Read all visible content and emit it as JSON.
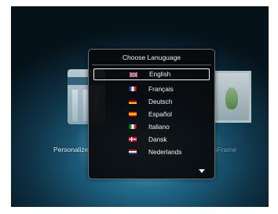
{
  "dialog": {
    "title": "Choose Lanuguage",
    "languages": [
      {
        "label": "English",
        "flag": "uk-flag-icon",
        "selected": true
      },
      {
        "label": "Français",
        "flag": "france-flag-icon",
        "selected": false
      },
      {
        "label": "Deutsch",
        "flag": "germany-flag-icon",
        "selected": false
      },
      {
        "label": "Español",
        "flag": "spain-flag-icon",
        "selected": false
      },
      {
        "label": "Italiano",
        "flag": "italy-flag-icon",
        "selected": false
      },
      {
        "label": "Dansk",
        "flag": "denmark-flag-icon",
        "selected": false
      },
      {
        "label": "Nederlands",
        "flag": "netherlands-flag-icon",
        "selected": false
      }
    ]
  },
  "background": {
    "left_label": "Personalize Frame",
    "right_label": "Start PhotoFrame"
  },
  "colors": {
    "dialog_bg": "#08090a",
    "highlight_border": "#f5f5f5",
    "text": "#f4f4f4"
  }
}
